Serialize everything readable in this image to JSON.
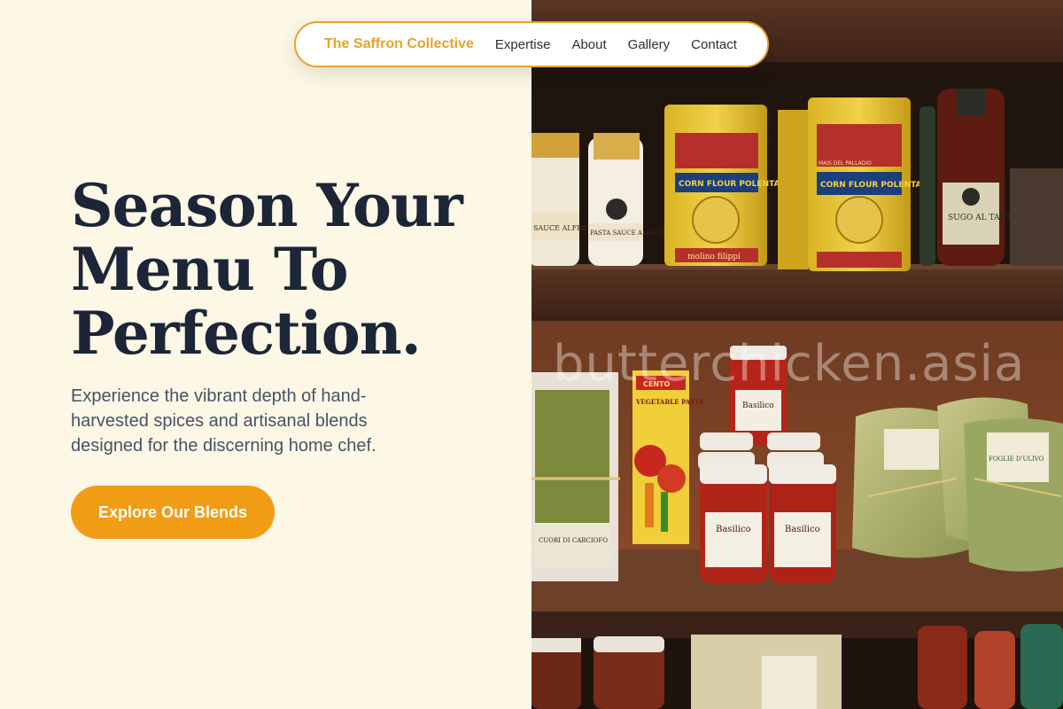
{
  "nav": {
    "brand": "The Saffron Collective",
    "links": [
      "Expertise",
      "About",
      "Gallery",
      "Contact"
    ]
  },
  "hero": {
    "headline_lines": [
      "Season Your",
      "Menu To",
      "Perfection."
    ],
    "subtext": "Experience the vibrant depth of hand-harvested spices and artisanal blends designed for the discerning home chef.",
    "cta_label": "Explore Our Blends"
  },
  "photo": {
    "watermark": "butterchicken.asia",
    "labels": {
      "jar_left_1": "SAUCE ALFREDO",
      "jar_left_2": "PASTA SAUCE ALFREDO",
      "polenta_brand": "MAIS DEL PALLADIO",
      "polenta_1": "CORN FLOUR POLENTA",
      "polenta_2": "CORN FLOUR POLENTA",
      "polenta_maker": "molino filippi",
      "bottle_1": "SUGO AL TARTUFO",
      "paste_brand": "CENTO",
      "paste": "VEGETABLE PASTE",
      "jar_basilico": "Basilico",
      "pasta_bag": "FOGLIE D'ULIVO",
      "carciofo": "CUORI DI CARCIOFO"
    }
  },
  "colors": {
    "accent": "#f19c15",
    "brand_text": "#e5a32b",
    "background": "#fdf8e6",
    "headline": "#1c2638"
  }
}
